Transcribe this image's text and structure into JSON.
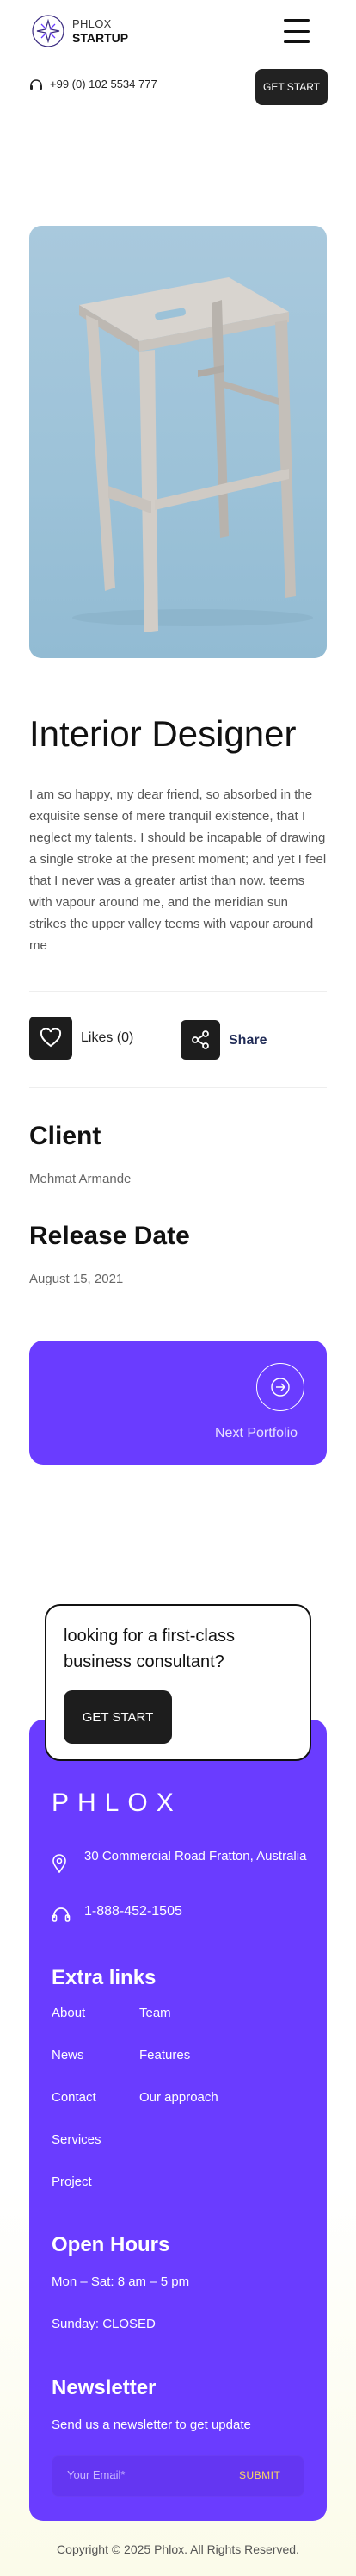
{
  "header": {
    "logo_line1": "PHLOX",
    "logo_line2": "STARTUP",
    "phone": "+99 (0) 102 5534 777",
    "cta_label": "GET START",
    "menu_icon": "hamburger-icon"
  },
  "project": {
    "title": "Interior Designer",
    "description": "I am so happy, my dear friend, so absorbed in the exquisite sense of mere tranquil existence, that I neglect my talents. I should be incapable of drawing a single stroke at the present moment; and yet I feel that I never was a greater artist than now. teems with vapour around me, and the meridian sun strikes the upper valley teems with vapour around me",
    "likes_label": "Likes (0)",
    "share_label": "Share",
    "client_heading": "Client",
    "client_value": "Mehmat Armande",
    "release_heading": "Release Date",
    "release_value": "August 15, 2021",
    "next_label": "Next Portfolio"
  },
  "cta": {
    "text": "looking for a first-class business consultant?",
    "button": "GET START"
  },
  "footer": {
    "brand": "PHLOX",
    "address": "30 Commercial Road Fratton, Australia",
    "phone": "1-888-452-1505",
    "extra_links_heading": "Extra links",
    "links_col1": [
      "About",
      "News",
      "Contact",
      "Services",
      "Project"
    ],
    "links_col2": [
      "Team",
      "Features",
      "Our approach"
    ],
    "hours_heading": "Open Hours",
    "hours_1": "Mon – Sat: 8 am – 5 pm",
    "hours_2": "Sunday: CLOSED",
    "newsletter_heading": "Newsletter",
    "newsletter_text": "Send us a newsletter to get update",
    "email_placeholder": "Your Email*",
    "submit_label": "SUBMIT"
  },
  "copyright": "Copyright © 2025 Phlox. All Rights Reserved.",
  "colors": {
    "accent": "#6a3cff",
    "dark": "#1d1d1d",
    "submit": "#ffd95e"
  }
}
